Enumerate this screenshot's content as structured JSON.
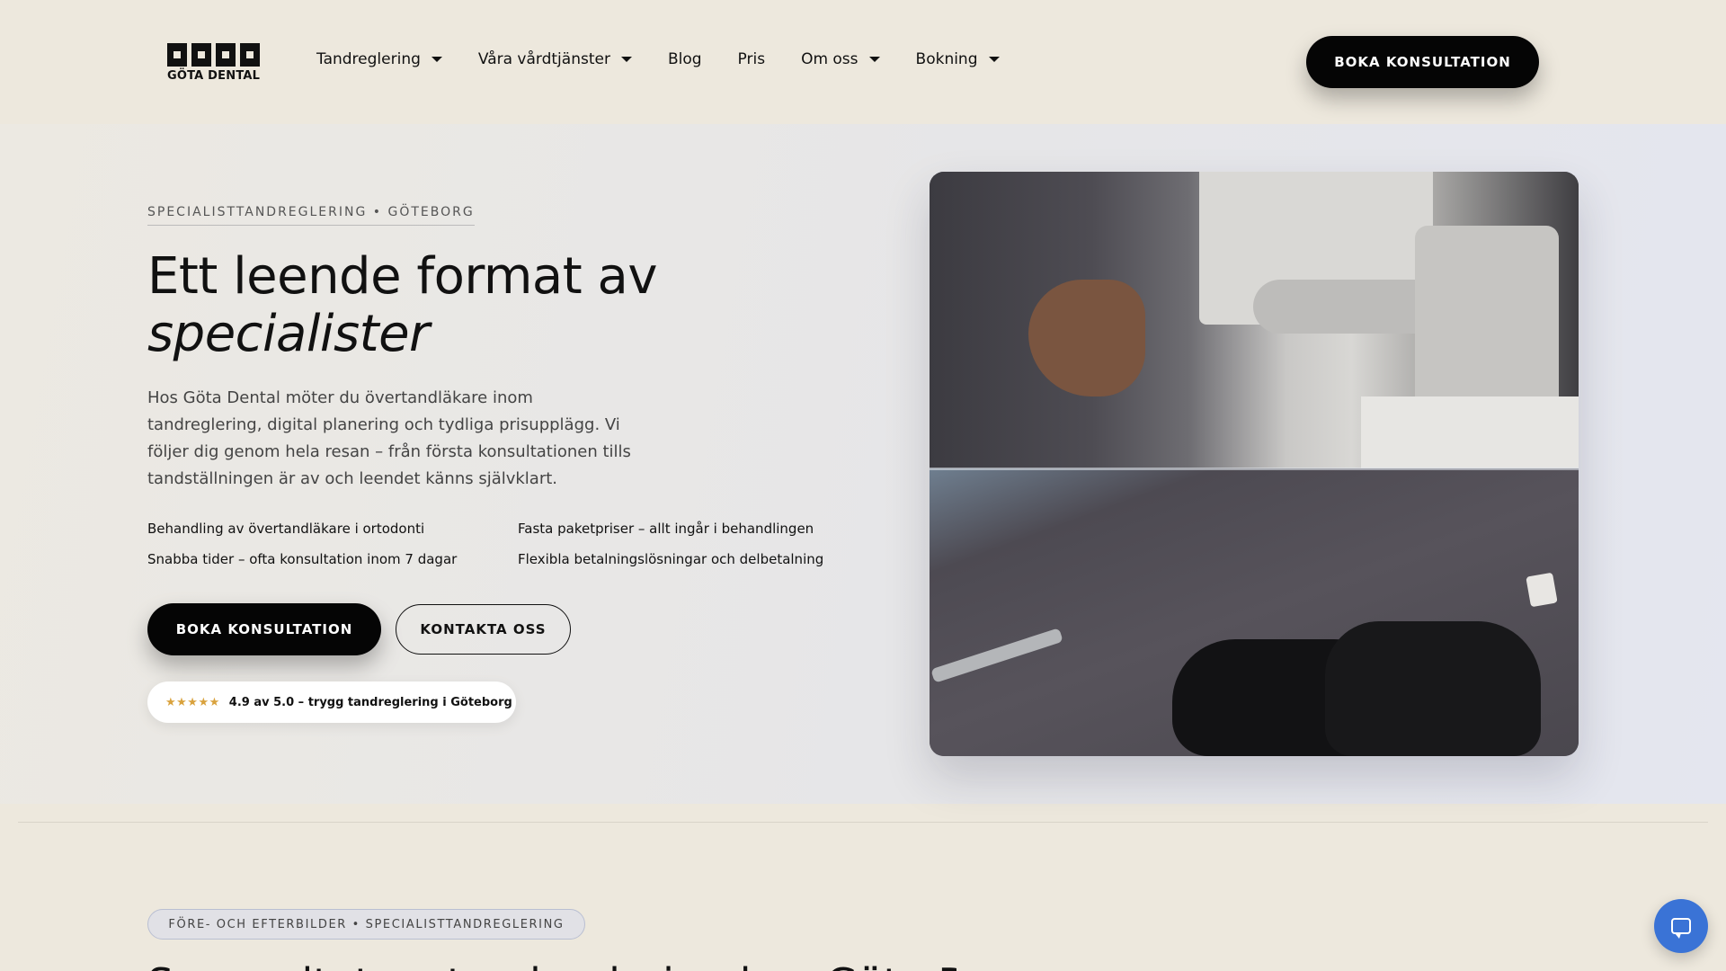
{
  "header": {
    "logo_text": "GÖTA DENTAL",
    "nav": [
      {
        "label": "Tandreglering",
        "has_dropdown": true
      },
      {
        "label": "Våra vårdtjänster",
        "has_dropdown": true
      },
      {
        "label": "Blog",
        "has_dropdown": false
      },
      {
        "label": "Pris",
        "has_dropdown": false
      },
      {
        "label": "Om oss",
        "has_dropdown": true
      },
      {
        "label": "Bokning",
        "has_dropdown": true
      }
    ],
    "cta_label": "BOKA KONSULTATION"
  },
  "hero": {
    "eyebrow": "SPECIALISTTANDREGLERING • GÖTEBORG",
    "headline_line1": "Ett leende format av",
    "headline_emphasis": "specialister",
    "lead": "Hos Göta Dental möter du övertandläkare inom tandreglering, digital planering och tydliga prisupplägg. Vi följer dig genom hela resan – från första konsultationen tills tandställningen är av och leendet känns självklart.",
    "features": [
      "Behandling av övertandläkare i ortodonti",
      "Fasta paketpriser – allt ingår i behandlingen",
      "Snabba tider – ofta konsultation inom 7 dagar",
      "Flexibla betalningslösningar och delbetalning"
    ],
    "primary_cta": "BOKA KONSULTATION",
    "secondary_cta": "KONTAKTA OSS",
    "rating": {
      "stars": "★★★★★",
      "text": "4.9 av 5.0 – trygg tandreglering i Göteborg",
      "value": 4.9,
      "max": 5.0
    }
  },
  "next_section": {
    "pill": "FÖRE- OCH EFTERBILDER • SPECIALISTTANDREGLERING",
    "heading_partial": "Se resultat av tandreglering hos Göta Dental"
  },
  "colors": {
    "background": "#ede8dd",
    "primary_button": "#050505",
    "chat_button": "#3a73d6",
    "star": "#d9a23d"
  },
  "icons": {
    "chat": "chat-bubble-icon",
    "dropdown": "caret-down-icon"
  }
}
